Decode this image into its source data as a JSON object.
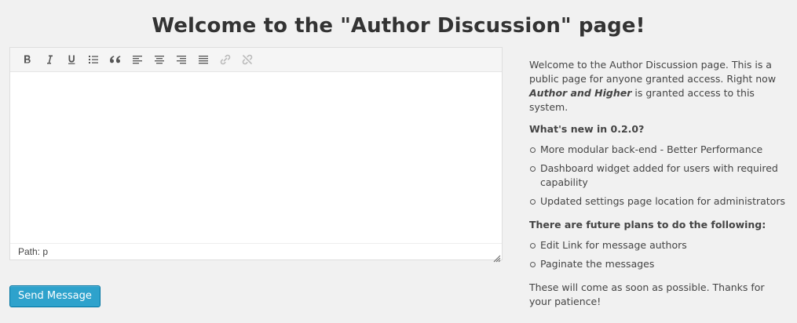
{
  "page": {
    "title": "Welcome to the \"Author Discussion\" page!"
  },
  "editor": {
    "toolbar_icons": [
      "bold-icon",
      "italic-icon",
      "underline-icon",
      "bullet-list-icon",
      "blockquote-icon",
      "align-left-icon",
      "align-center-icon",
      "align-right-icon",
      "align-justify-icon",
      "insert-link-icon",
      "remove-link-icon"
    ],
    "status_path": "Path: p"
  },
  "actions": {
    "send_label": "Send Message",
    "send_color": "#2ea2cc"
  },
  "sidebar": {
    "intro_before": "Welcome to the Author Discussion page. This is a public page for anyone granted access. Right now ",
    "intro_emphasis": "Author and Higher",
    "intro_after": " is granted access to this system.",
    "whats_new_heading": "What's new in 0.2.0?",
    "whats_new_items": [
      "More modular back-end - Better Performance",
      "Dashboard widget added for users with required capability",
      "Updated settings page location for administrators"
    ],
    "future_heading": "There are future plans to do the following:",
    "future_items": [
      "Edit Link for message authors",
      "Paginate the messages"
    ],
    "closing": "These will come as soon as possible. Thanks for your patience!"
  }
}
